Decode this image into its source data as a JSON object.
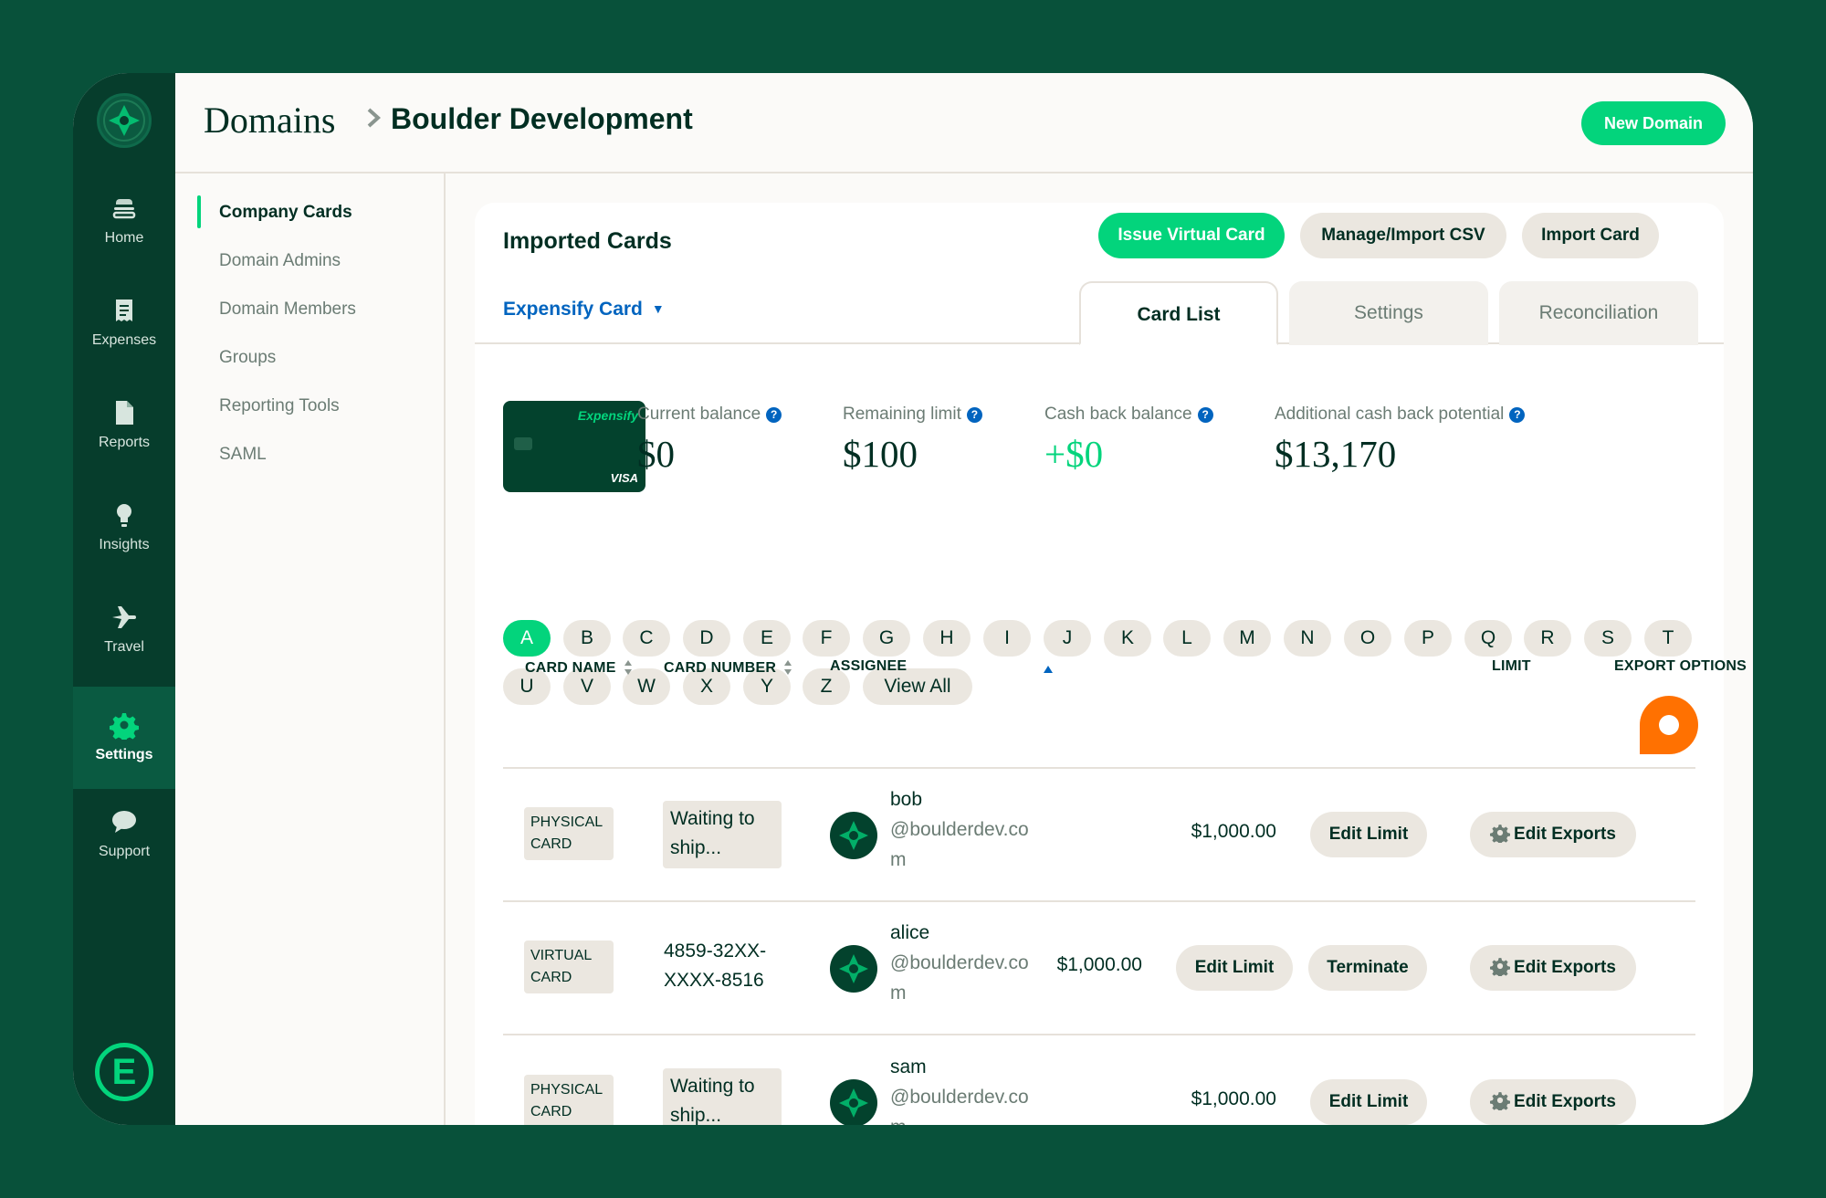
{
  "nav": {
    "items": [
      {
        "label": "Home"
      },
      {
        "label": "Expenses"
      },
      {
        "label": "Reports"
      },
      {
        "label": "Insights"
      },
      {
        "label": "Travel"
      },
      {
        "label": "Settings"
      },
      {
        "label": "Support"
      }
    ],
    "active": "Settings"
  },
  "header": {
    "breadcrumb_root": "Domains",
    "breadcrumb_leaf": "Boulder Development",
    "new_domain": "New Domain"
  },
  "subnav": {
    "items": [
      {
        "label": "Company Cards"
      },
      {
        "label": "Domain Admins"
      },
      {
        "label": "Domain Members"
      },
      {
        "label": "Groups"
      },
      {
        "label": "Reporting Tools"
      },
      {
        "label": "SAML"
      }
    ]
  },
  "panel": {
    "title": "Imported Cards",
    "issue_virtual_card": "Issue Virtual Card",
    "manage_import_csv": "Manage/Import CSV",
    "import_card": "Import Card",
    "card_feed": "Expensify Card",
    "tabs": [
      {
        "label": "Card List"
      },
      {
        "label": "Settings"
      },
      {
        "label": "Reconciliation"
      }
    ],
    "card_image": {
      "brand": "Expensify",
      "network": "VISA"
    },
    "stats": [
      {
        "label": "Current balance",
        "value": "$0"
      },
      {
        "label": "Remaining limit",
        "value": "$100"
      },
      {
        "label": "Cash back balance",
        "value": "+$0"
      },
      {
        "label": "Additional cash back potential",
        "value": "$13,170"
      }
    ]
  },
  "letters": [
    "A",
    "B",
    "C",
    "D",
    "E",
    "F",
    "G",
    "H",
    "I",
    "J",
    "K",
    "L",
    "M",
    "N",
    "O",
    "P",
    "Q",
    "R",
    "S",
    "T",
    "U",
    "V",
    "W",
    "X",
    "Y",
    "Z",
    "View All"
  ],
  "table": {
    "headers": {
      "card_name": "CARD NAME",
      "card_number": "CARD NUMBER",
      "assignee": "ASSIGNEE",
      "limit": "LIMIT",
      "export_options": "EXPORT OPTIONS"
    },
    "rows": [
      {
        "type_line1": "PHYSICAL",
        "type_line2": "CARD",
        "number_line1": "Waiting to",
        "number_line2": "ship...",
        "name": "bob",
        "email_line1": "@boulderdev.co",
        "email_line2": "m",
        "limit": "$1,000.00",
        "edit_limit": "Edit Limit",
        "edit_exports": "Edit Exports"
      },
      {
        "type_line1": "VIRTUAL",
        "type_line2": "CARD",
        "number_line1": "4859-32XX-",
        "number_line2": "XXXX-8516",
        "name": "alice",
        "email_line1": "@boulderdev.co",
        "email_line2": "m",
        "limit": "$1,000.00",
        "edit_limit": "Edit Limit",
        "terminate": "Terminate",
        "edit_exports": "Edit Exports"
      },
      {
        "type_line1": "PHYSICAL",
        "type_line2": "CARD",
        "number_line1": "Waiting to",
        "number_line2": "ship...",
        "name": "sam",
        "email_line1": "@boulderdev.co",
        "email_line2": "m",
        "limit": "$1,000.00",
        "edit_limit": "Edit Limit",
        "edit_exports": "Edit Exports"
      }
    ]
  },
  "colors": {
    "background": "#08513a",
    "nav": "#063d2c",
    "accent_green": "#03d47c",
    "link_blue": "#0164bf",
    "chat_orange": "#ff7101"
  }
}
